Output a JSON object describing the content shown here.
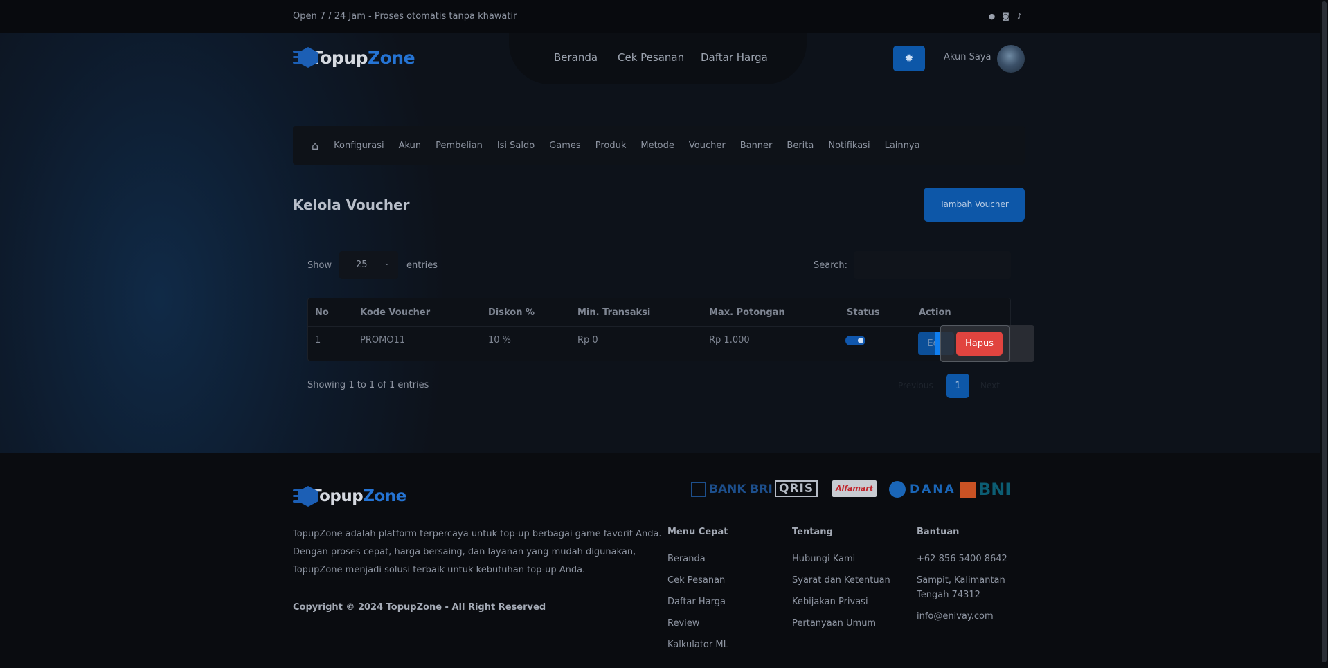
{
  "topbar": {
    "tagline": "Open 7 / 24 Jam - Proses otomatis tanpa khawatir",
    "social_icons": [
      "whatsapp-icon",
      "instagram-icon",
      "tiktok-icon"
    ]
  },
  "brand": {
    "name_a": "Topup",
    "name_b": "Zone",
    "accent": "#2574d4"
  },
  "header": {
    "menu": [
      "Beranda",
      "Cek Pesanan",
      "Daftar Harga"
    ],
    "account_label": "Akun Saya"
  },
  "admin_nav": [
    "Konfigurasi",
    "Akun",
    "Pembelian",
    "Isi Saldo",
    "Games",
    "Produk",
    "Metode",
    "Voucher",
    "Banner",
    "Berita",
    "Notifikasi",
    "Lainnya"
  ],
  "page": {
    "title": "Kelola Voucher",
    "add_button": "Tambah Voucher"
  },
  "table_controls": {
    "show_label": "Show",
    "entries_value": "25",
    "entries_label": "entries",
    "search_label": "Search:"
  },
  "table": {
    "headers": [
      "No",
      "Kode Voucher",
      "Diskon %",
      "Min. Transaksi",
      "Max. Potongan",
      "Status",
      "Action"
    ],
    "rows": [
      {
        "no": "1",
        "code": "PROMO11",
        "discount": "10 %",
        "min": "Rp 0",
        "max": "Rp 1.000",
        "status_on": true
      }
    ],
    "edit_label": "Edit",
    "delete_label": "Hapus"
  },
  "pagination": {
    "info": "Showing 1 to 1 of 1 entries",
    "prev": "Previous",
    "current": "1",
    "next": "Next"
  },
  "footer": {
    "description": [
      "TopupZone adalah platform terpercaya untuk top-up berbagai game favorit Anda.",
      "Dengan proses cepat, harga bersaing, dan layanan yang mudah digunakan,",
      "TopupZone menjadi solusi terbaik untuk kebutuhan top-up Anda."
    ],
    "copyright": "Copyright © 2024 TopupZone - All Right Reserved",
    "payments": {
      "bri": "BANK BRI",
      "qris": "QRIS",
      "alfamart": "Alfamart",
      "dana": "DANA",
      "bni": "BNI"
    },
    "menu_cepat": {
      "title": "Menu Cepat",
      "links": [
        "Beranda",
        "Cek Pesanan",
        "Daftar Harga",
        "Review",
        "Kalkulator ML"
      ]
    },
    "tentang": {
      "title": "Tentang",
      "links": [
        "Hubungi Kami",
        "Syarat dan Ketentuan",
        "Kebijakan Privasi",
        "Pertanyaan Umum"
      ]
    },
    "bantuan": {
      "title": "Bantuan",
      "phone": "+62 856 5400 8642",
      "address_1": "Sampit, Kalimantan",
      "address_2": "Tengah 74312",
      "email": "info@enivay.com"
    }
  }
}
